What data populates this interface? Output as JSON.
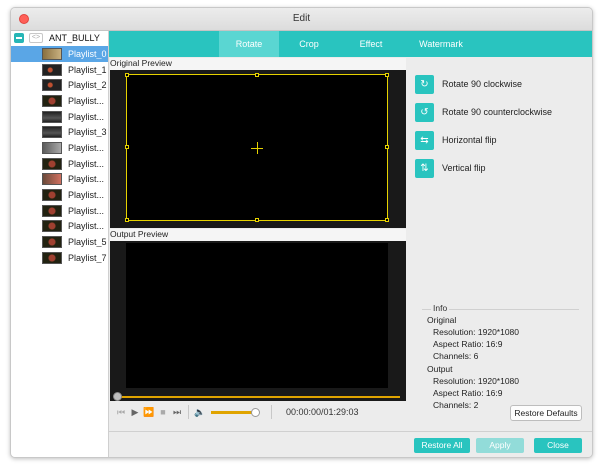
{
  "window": {
    "title": "Edit"
  },
  "sidebar": {
    "project_name": "ANT_BULLY",
    "items": [
      {
        "label": "Playlist_0",
        "selected": true
      },
      {
        "label": "Playlist_1"
      },
      {
        "label": "Playlist_2"
      },
      {
        "label": "Playlist..."
      },
      {
        "label": "Playlist..."
      },
      {
        "label": "Playlist_3"
      },
      {
        "label": "Playlist..."
      },
      {
        "label": "Playlist..."
      },
      {
        "label": "Playlist..."
      },
      {
        "label": "Playlist..."
      },
      {
        "label": "Playlist..."
      },
      {
        "label": "Playlist..."
      },
      {
        "label": "Playlist_5"
      },
      {
        "label": "Playlist_7"
      }
    ]
  },
  "tabs": [
    {
      "label": "Rotate",
      "active": true
    },
    {
      "label": "Crop"
    },
    {
      "label": "Effect"
    },
    {
      "label": "Watermark"
    }
  ],
  "preview": {
    "original_label": "Original Preview",
    "output_label": "Output Preview"
  },
  "player": {
    "time": "00:00:00/01:29:03",
    "volume_level": 0.85,
    "progress": 0.0
  },
  "actions": [
    {
      "label": "Rotate 90 clockwise",
      "icon": "rotate-clockwise-icon"
    },
    {
      "label": "Rotate 90 counterclockwise",
      "icon": "rotate-counterclockwise-icon"
    },
    {
      "label": "Horizontal flip",
      "icon": "horizontal-flip-icon"
    },
    {
      "label": "Vertical flip",
      "icon": "vertical-flip-icon"
    }
  ],
  "info": {
    "title": "Info",
    "original_heading": "Original",
    "original": {
      "resolution": "Resolution: 1920*1080",
      "aspect": "Aspect Ratio: 16:9",
      "channels": "Channels: 6"
    },
    "output_heading": "Output",
    "output": {
      "resolution": "Resolution: 1920*1080",
      "aspect": "Aspect Ratio: 16:9",
      "channels": "Channels: 2"
    },
    "restore_defaults": "Restore Defaults"
  },
  "footer": {
    "restore_all": "Restore All",
    "apply": "Apply",
    "close": "Close"
  },
  "colors": {
    "accent": "#29c4bf",
    "progress": "#e0a400",
    "crop_frame": "#e6d200",
    "selection": "#5aa6e6"
  }
}
